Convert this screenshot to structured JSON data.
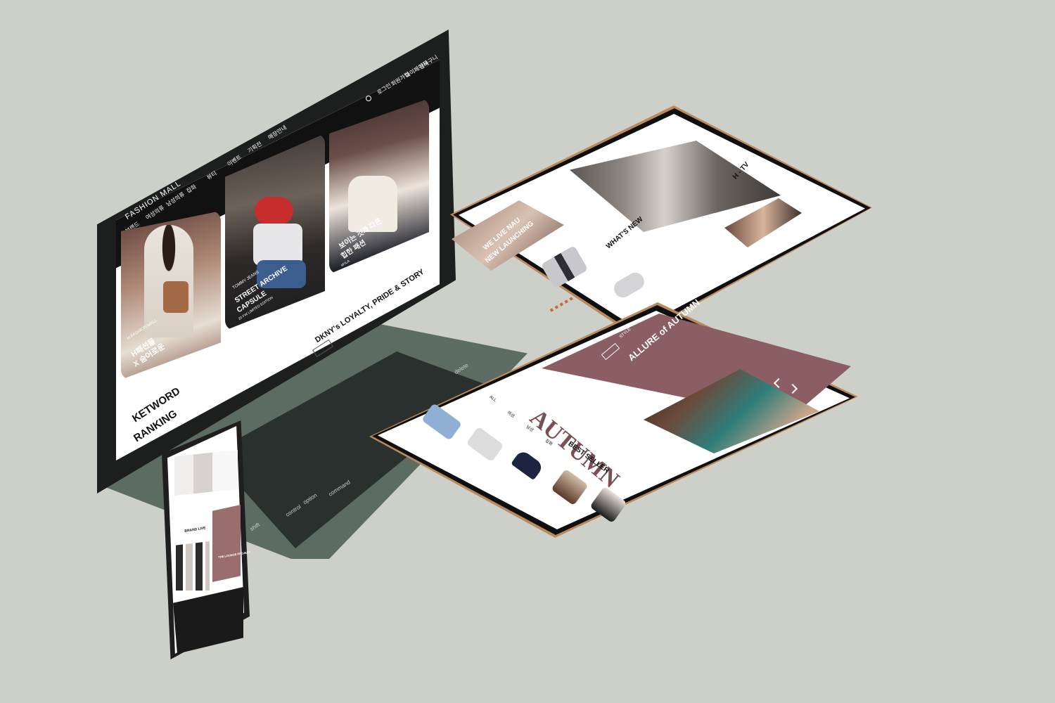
{
  "laptop": {
    "brand": "FASHION MALL",
    "top_links": [
      "로그인",
      "회원가입",
      "마이페이지",
      "장바구니"
    ],
    "categories": [
      "브랜드",
      "여성의류",
      "남성의류",
      "잡화",
      "뷰티",
      "이벤트",
      "기획전",
      "매장안내"
    ],
    "cards": [
      {
        "title_line1": "H패션몰",
        "title_line2": "X 숨어로운",
        "caption": "H FASHION MALL"
      },
      {
        "tag": "TOMMY JEANS",
        "title_line1": "STREET ARCHIVE",
        "title_line2": "CAPSULE",
        "caption": "20 FW LIMITED EDITION"
      },
      {
        "title_line1": "보이는 것과 다른",
        "title_line2": "힙한 패션",
        "caption": "#FILA"
      }
    ],
    "story_title": "DKNY's LOYALTY, PRIDE & STORY",
    "view_more": "VIEW MORE",
    "keyword_line1": "KETWORD",
    "keyword_line2": "RANKING",
    "keys": [
      "delete",
      "shift",
      "option",
      "command",
      "control"
    ]
  },
  "tablet_top": {
    "htv_title": "H - TV",
    "new_title": "WHAT'S NEW",
    "banner_line1": "WE LIVE NAU",
    "banner_line2": "NEW LAUNCHING"
  },
  "tablet_bottom": {
    "style_tag": "STYLE",
    "headline": "ALLURE of AUTUMN",
    "shop_now": "SHOP NOW",
    "autumn": "AUTUMN",
    "best_title": "BEST SELLER",
    "tabs": [
      "ALL",
      "여성",
      "남성",
      "잡화"
    ]
  },
  "phone": {
    "section_title": "BRAND LIVE",
    "card_text": "THE LOUNGE PROJECT"
  }
}
